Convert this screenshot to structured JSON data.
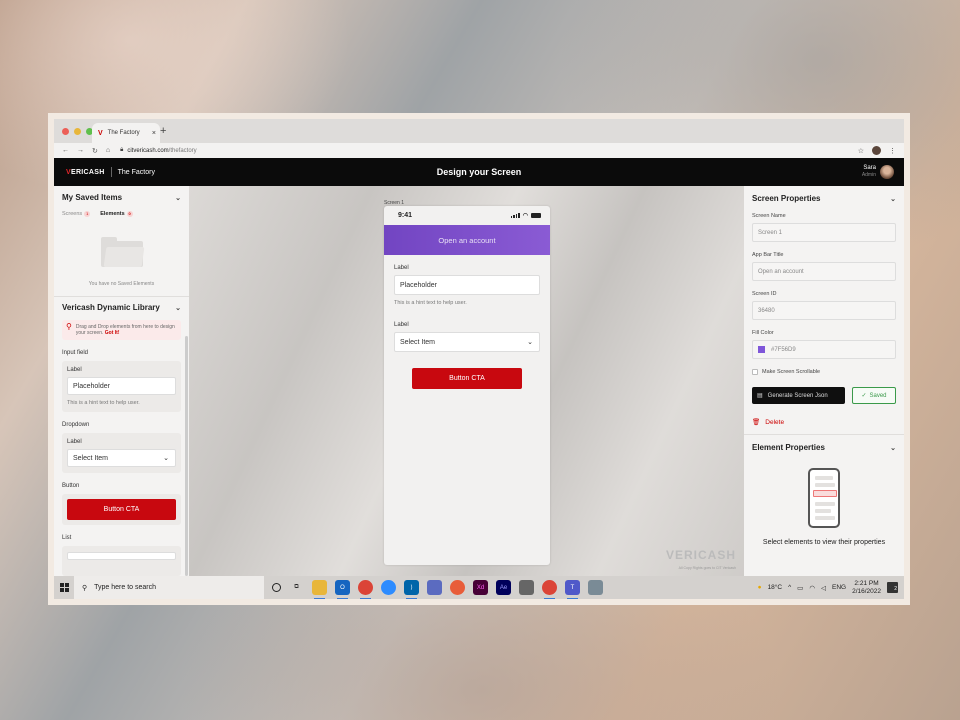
{
  "browser": {
    "tab_title": "The Factory",
    "new_tab": "+",
    "url_host": "citvericash.com",
    "url_path": "/thefactory"
  },
  "header": {
    "logo_red": "V",
    "logo_rest": "ERICASH",
    "product": "The Factory",
    "title": "Design your Screen",
    "user_name": "Sara",
    "user_role": "Admin"
  },
  "left": {
    "saved_title": "My Saved Items",
    "tab_screens": "Screens",
    "tab_screens_count": "1",
    "tab_elements": "Elements",
    "tab_elements_count": "0",
    "empty_text": "You have no Saved Elements",
    "library_title": "Vericash Dynamic Library",
    "hint_text": "Drag and Drop elements from here to design your screen.",
    "hint_gotit": "Got It!",
    "input_section": "Input field",
    "input_label": "Label",
    "input_value": "Placeholder",
    "input_hint": "This is a hint text to help user.",
    "dropdown_section": "Dropdown",
    "dropdown_label": "Label",
    "dropdown_value": "Select Item",
    "button_section": "Button",
    "button_label": "Button CTA",
    "list_section": "List"
  },
  "canvas": {
    "screen_label": "Screen 1",
    "time": "9:41",
    "appbar_title": "Open an account",
    "input_label": "Label",
    "input_value": "Placeholder",
    "input_hint": "This is a hint text to help user.",
    "dropdown_label": "Label",
    "dropdown_value": "Select Item",
    "button_label": "Button CTA",
    "watermark": "VERICASH",
    "watermark_sub": "All Copy Rights goes to CIT Vericash"
  },
  "right": {
    "screen_props_title": "Screen Properties",
    "screen_name_label": "Screen Name",
    "screen_name_value": "Screen 1",
    "app_bar_label": "App Bar Title",
    "app_bar_value": "Open an account",
    "screen_id_label": "Screen ID",
    "screen_id_value": "36480",
    "fill_color_label": "Fill Color",
    "fill_color_value": "#7F56D9",
    "scrollable_label": "Make Screen Scrollable",
    "generate_button": "Generate Screen Json",
    "saved_button": "Saved",
    "delete_button": "Delete",
    "element_props_title": "Element Properties",
    "element_empty_text": "Select elements to view their properties"
  },
  "taskbar": {
    "search_placeholder": "Type here to search",
    "weather": "18°C",
    "language": "ENG",
    "time": "2:21 PM",
    "date": "2/16/2022",
    "notifications": "2"
  },
  "colors": {
    "accent_purple": "#7F56D9",
    "brand_red": "#C8080F",
    "header_black": "#0B0B0B",
    "saved_green": "#3A9A4A"
  }
}
